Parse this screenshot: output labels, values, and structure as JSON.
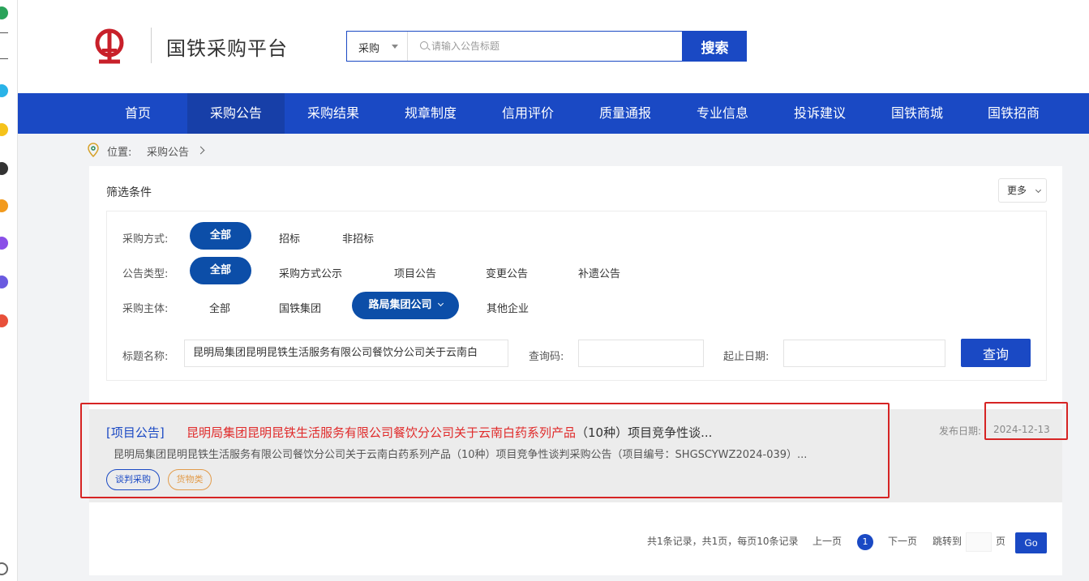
{
  "app": {
    "title": "国铁采购平台"
  },
  "search": {
    "category": "采购",
    "placeholder": "请输入公告标题",
    "button_label": "搜索"
  },
  "nav": {
    "items": [
      {
        "label": "首页",
        "active": false
      },
      {
        "label": "采购公告",
        "active": true
      },
      {
        "label": "采购结果",
        "active": false
      },
      {
        "label": "规章制度",
        "active": false
      },
      {
        "label": "信用评价",
        "active": false
      },
      {
        "label": "质量通报",
        "active": false
      },
      {
        "label": "专业信息",
        "active": false
      },
      {
        "label": "投诉建议",
        "active": false
      },
      {
        "label": "国铁商城",
        "active": false
      },
      {
        "label": "国铁招商",
        "active": false
      }
    ]
  },
  "breadcrumb": {
    "prefix": "位置:",
    "current": "采购公告"
  },
  "filter": {
    "title": "筛选条件",
    "more_label": "更多",
    "method": {
      "label": "采购方式:",
      "options": [
        "全部",
        "招标",
        "非招标"
      ],
      "selected": "全部"
    },
    "type": {
      "label": "公告类型:",
      "options": [
        "全部",
        "采购方式公示",
        "项目公告",
        "变更公告",
        "补遗公告"
      ],
      "selected": "全部"
    },
    "subject": {
      "label": "采购主体:",
      "options": [
        "全部",
        "国铁集团",
        "路局集团公司",
        "其他企业"
      ],
      "selected": "路局集团公司"
    },
    "title_field": {
      "label": "标题名称:",
      "value": "昆明局集团昆明昆铁生活服务有限公司餐饮分公司关于云南白"
    },
    "code_field": {
      "label": "查询码:",
      "value": ""
    },
    "date_field": {
      "label": "起止日期:",
      "value": ""
    },
    "query_button": "查询"
  },
  "results": [
    {
      "type": "[项目公告]",
      "title_highlight": "昆明局集团昆明昆铁生活服务有限公司餐饮分公司关于云南白药系列产品",
      "title_rest": "（10种）项目竞争性谈...",
      "summary": "昆明局集团昆明昆铁生活服务有限公司餐饮分公司关于云南白药系列产品（10种）项目竞争性谈判采购公告（项目编号：SHGSCYWZ2024-039）...",
      "date_label": "发布日期:",
      "date": "2024-12-13",
      "tags": [
        "谈判采购",
        "货物类"
      ]
    }
  ],
  "pagination": {
    "summary": "共1条记录，共1页，每页10条记录",
    "prev": "上一页",
    "current_page": "1",
    "next": "下一页",
    "jump_label": "跳转到",
    "page_suffix": "页",
    "go_label": "Go"
  },
  "colors": {
    "primary": "#1a49c4",
    "pill": "#0c4ea8",
    "highlight_title": "#e02a2a",
    "annotation_box": "#d62424",
    "tag_orange": "#e29b4a"
  }
}
